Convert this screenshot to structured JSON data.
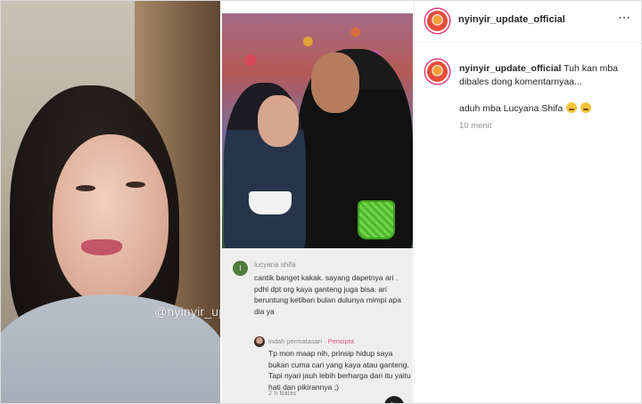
{
  "post": {
    "username": "nyinyir_update_official",
    "more_icon": "more-horizontal-icon"
  },
  "media": {
    "watermark": "@nyinyir_update_official",
    "comment": {
      "avatar_letter": "l",
      "username": "lucyana shifa",
      "text": "cantik banget kakak. sayang dapetnya ari . pdhl dpt org kaya ganteng juga bisa. ari beruntung ketiban bulan dulunya mimpi apa dia ya"
    },
    "reply": {
      "username": "indah permatasari",
      "tag": "· Pencipta",
      "text": "Tp mon maap nih, prinsip hidup saya bukan cuma cari yang kaya atau ganteng. Tapi nyari jauh lebih berharga dari itu yaitu hati dan pikirannya ;)",
      "meta": "2 h   Balas"
    },
    "sound_icon": "speaker-icon"
  },
  "caption": {
    "username": "nyinyir_update_official",
    "line1": "Tuh kan mba dibales dong komentarnyaa...",
    "line2": "aduh mba Lucyana Shifa",
    "emojis": [
      "sad-face-emoji",
      "sad-face-emoji"
    ],
    "time": "10 menit"
  }
}
